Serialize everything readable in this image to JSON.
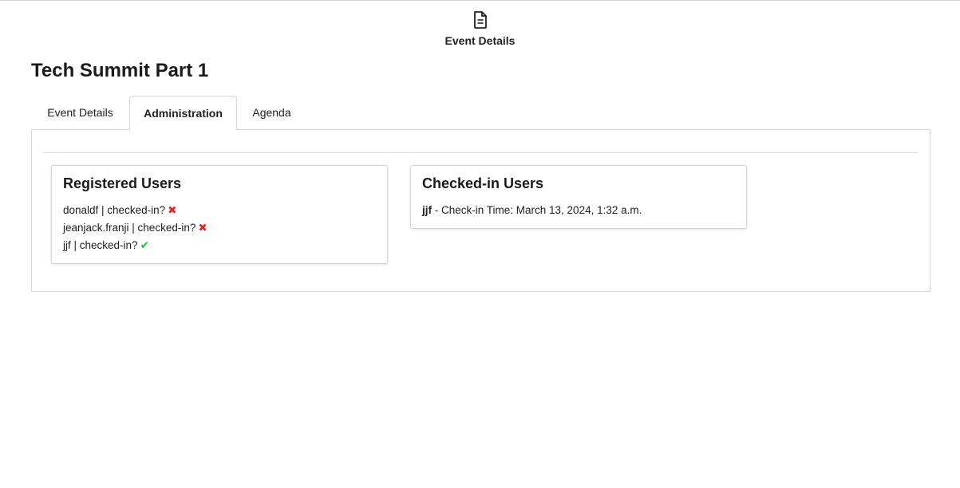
{
  "header": {
    "icon": "file-text-icon",
    "label": "Event Details"
  },
  "page": {
    "title": "Tech Summit Part 1"
  },
  "tabs": [
    {
      "label": "Event Details",
      "active": false
    },
    {
      "label": "Administration",
      "active": true
    },
    {
      "label": "Agenda",
      "active": false
    }
  ],
  "registered": {
    "title": "Registered Users",
    "users": [
      {
        "text": "donaldf | checked-in?",
        "checked_in": false,
        "icon": "x-icon"
      },
      {
        "text": "jeanjack.franji | checked-in?",
        "checked_in": false,
        "icon": "x-icon"
      },
      {
        "text": "jjf | checked-in?",
        "checked_in": true,
        "icon": "checkmark-icon"
      }
    ]
  },
  "checked_in": {
    "title": "Checked-in Users",
    "entries": [
      {
        "username": "jjf",
        "detail": " - Check-in Time: March 13, 2024, 1:32 a.m."
      }
    ]
  },
  "colors": {
    "x_mark": "#db2828",
    "check_mark": "#21ba45",
    "border": "#d4d4d4"
  }
}
